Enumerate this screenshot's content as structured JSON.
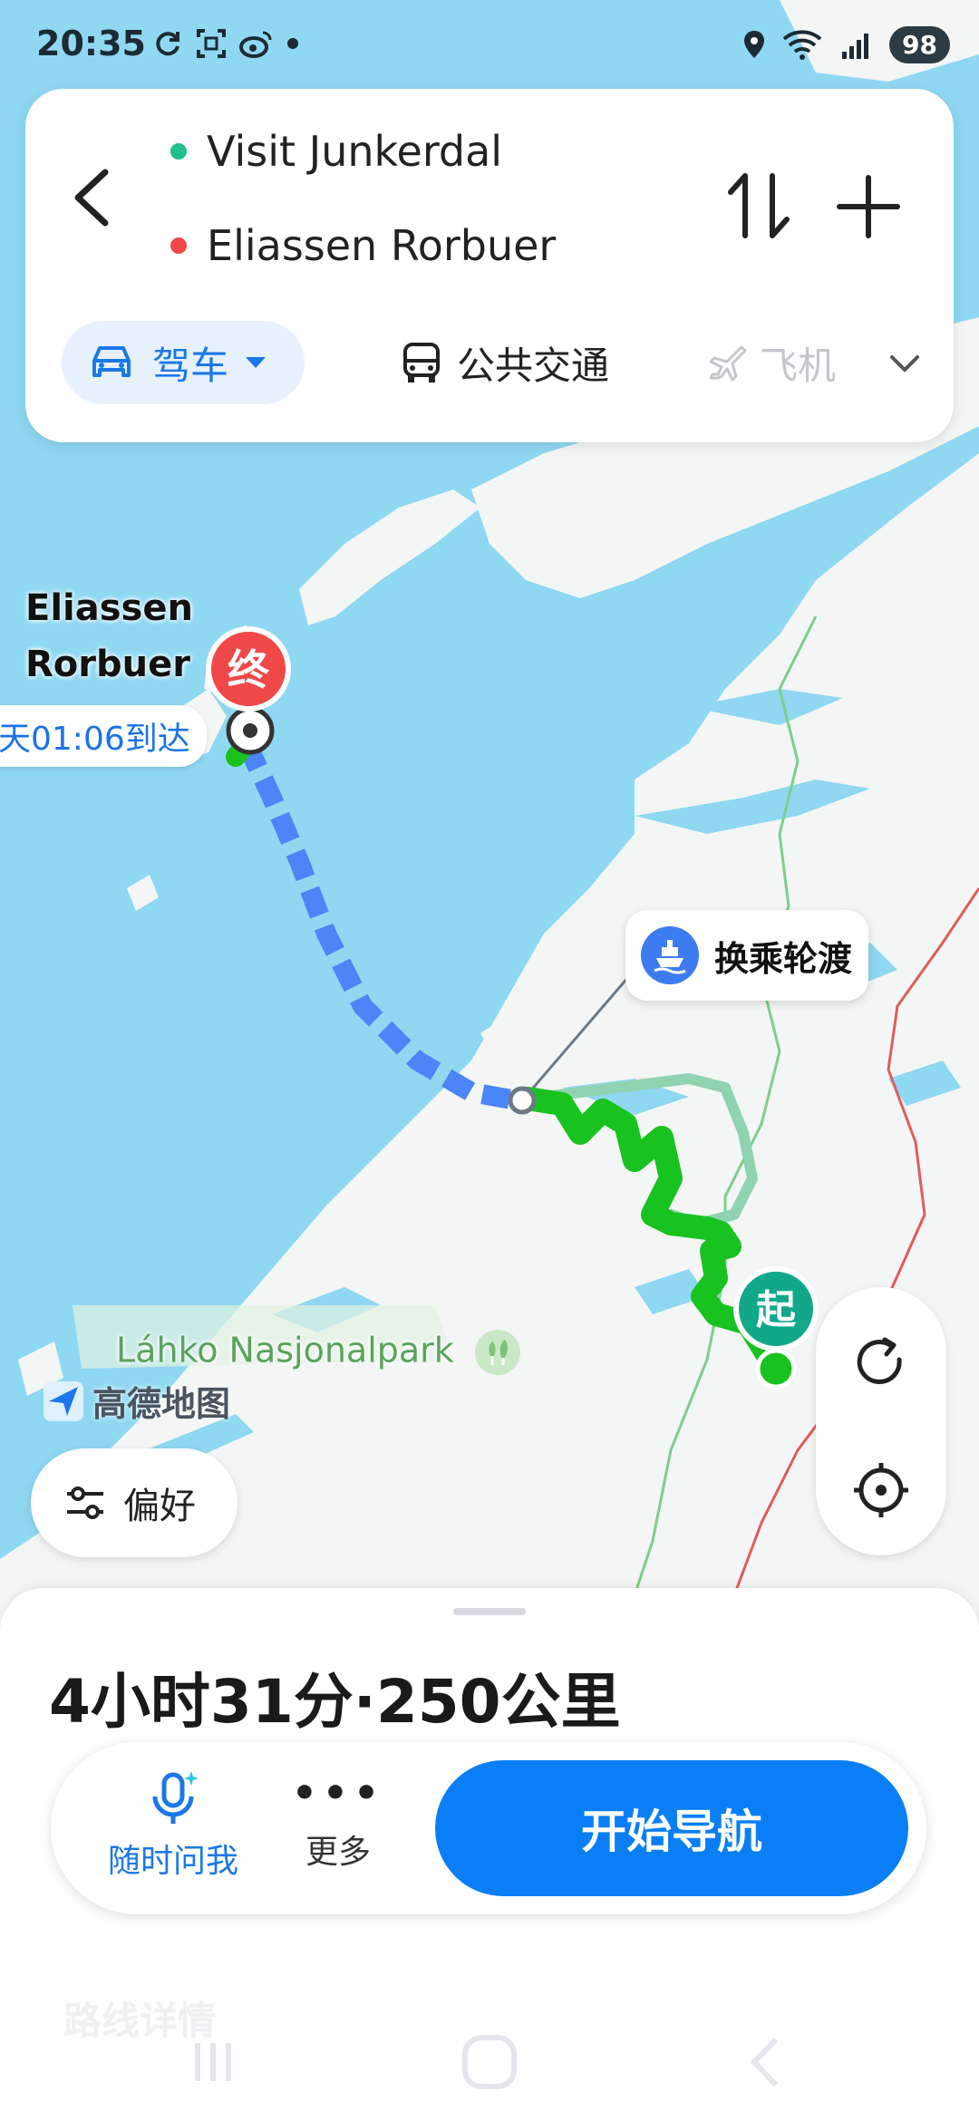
{
  "status_bar": {
    "time": "20:35",
    "battery": "98",
    "left_icons": [
      "sync-icon",
      "scan-icon",
      "weibo-icon",
      "dot-icon"
    ],
    "right_icons": [
      "location-icon",
      "wifi-icon",
      "signal-5g-icon"
    ]
  },
  "route_card": {
    "origin": "Visit Junkerdal",
    "destination": "Eliassen Rorbuer",
    "origin_color": "#1fbf8f",
    "destination_color": "#f04848",
    "modes": {
      "drive": "驾车",
      "transit": "公共交通",
      "plane": "飞机"
    }
  },
  "map": {
    "destination_label": [
      "Eliassen",
      "Rorbuer"
    ],
    "eta": "天01:06到达",
    "end_marker": "终",
    "start_marker": "起",
    "ferry_tip": "换乘轮渡",
    "park_label": "Láhko Nasjonalpark",
    "brand": "高德地图",
    "route_color": "#18c21f",
    "ferry_color": "#4a86f7"
  },
  "controls": {
    "prefs": "偏好"
  },
  "sheet": {
    "summary": "4小时31分·250公里",
    "ask": "随时问我",
    "more": "更多",
    "start": "开始导航",
    "details": "路线详情"
  }
}
